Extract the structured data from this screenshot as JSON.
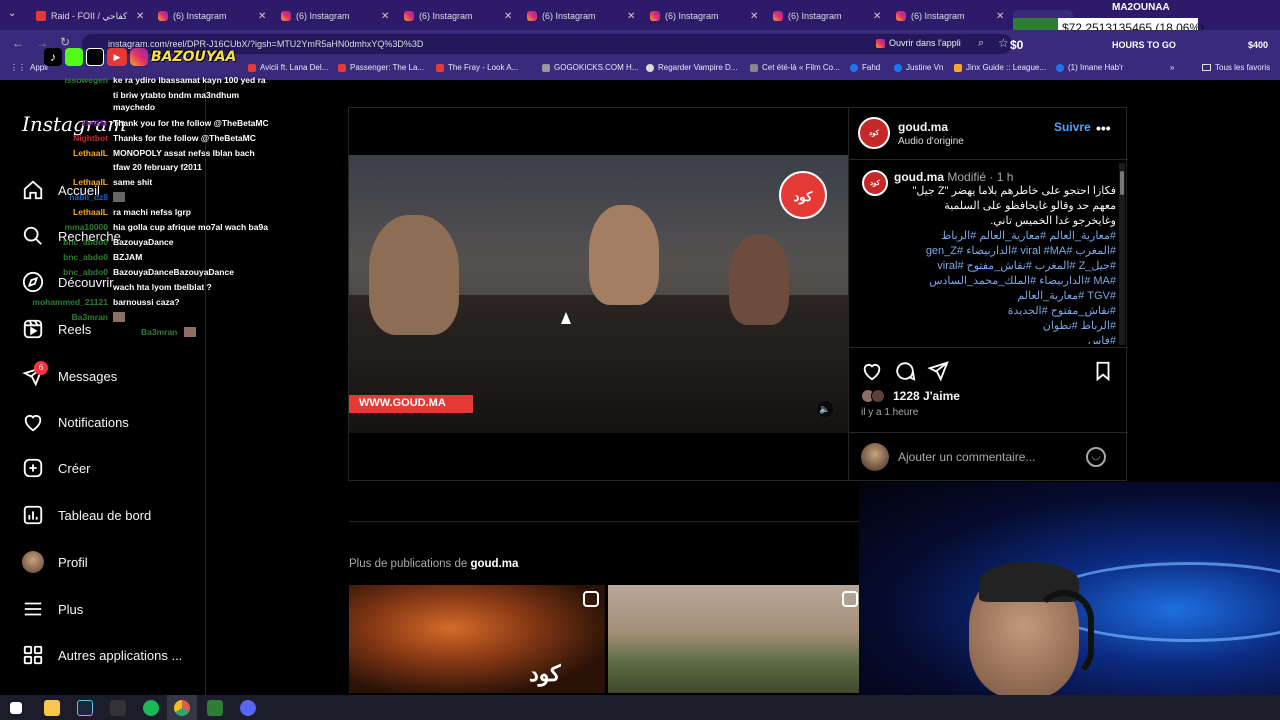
{
  "browser": {
    "tabs": [
      {
        "label": "Raid - FOII / كفاحي",
        "icon": "youtube-icon"
      },
      {
        "label": "(6) Instagram",
        "icon": "instagram-icon"
      },
      {
        "label": "(6) Instagram",
        "icon": "instagram-icon"
      },
      {
        "label": "(6) Instagram",
        "icon": "instagram-icon"
      },
      {
        "label": "(6) Instagram",
        "icon": "instagram-icon"
      },
      {
        "label": "(6) Instagram",
        "icon": "instagram-icon"
      },
      {
        "label": "(6) Instagram",
        "icon": "instagram-icon"
      },
      {
        "label": "(6) Instagram",
        "icon": "instagram-icon"
      }
    ],
    "url": "instagram.com/reel/DPR-J16CUbX/?igsh=MTU2YmR5aHN0dmhxYQ%3D%3D",
    "open_in_app": "Ouvrir dans l'appli",
    "bookmarks": [
      "Avicii ft. Lana Del...",
      "Passenger: The La...",
      "The Fray - Look A...",
      "GOGOKICKS.COM H...",
      "Regarder Vampire D...",
      "Cet été-là « Film Co...",
      "Fahd",
      "Justine Vn",
      "Jinx Guide :: League...",
      "(1) Imane Hab'r"
    ],
    "all_bookmarks": "Tous les favoris",
    "apps_label": "Appli"
  },
  "overlay": {
    "price": "$72.2513135465 (18.06%)",
    "counter": "$0",
    "hours": "HOURS TO GO",
    "streamer_name": "MA2OUNAA",
    "money": "$400",
    "social_handle": "BAZOUYAA"
  },
  "chat": [
    {
      "user": "issowegen",
      "msg": "ke ra ydiro lbassamat kayn 100 yed ra",
      "color": "#2e7d32"
    },
    {
      "user": "",
      "msg": "ti briw ytabto bndm ma3ndhum",
      "color": "#2e7d32"
    },
    {
      "user": "",
      "msg": "maychedo",
      "color": "#2e7d32"
    },
    {
      "user": "BetMc",
      "msg": "Thank you for the follow @TheBetaMC",
      "color": "#6a1b9a"
    },
    {
      "user": "Nightbot",
      "msg": "Thanks for the follow @TheBetaMC",
      "color": "#c62828"
    },
    {
      "user": "LethaalL",
      "msg": "MONOPOLY assat nefss lblan bach",
      "color": "#f9a825"
    },
    {
      "user": "",
      "msg": "tfaw 20 february f2011",
      "color": "#f9a825"
    },
    {
      "user": "LethaalL",
      "msg": "same shit",
      "color": "#f9a825"
    },
    {
      "user": "nabil_dz8",
      "msg": "",
      "color": "#1565c0"
    },
    {
      "user": "LethaalL",
      "msg": "ra machi nefss lgrp",
      "color": "#f9a825"
    },
    {
      "user": "mma10000",
      "msg": "hia golla cup afrique mo7al wach ba9a",
      "color": "#2e7d32"
    },
    {
      "user": "bnc_abdo0",
      "msg": "BazouyaDance",
      "color": "#2e7d32"
    },
    {
      "user": "bnc_abdo0",
      "msg": "BZJAM",
      "color": "#2e7d32"
    },
    {
      "user": "bnc_abdo0",
      "msg": "BazouyaDanceBazouyaDance",
      "color": "#2e7d32"
    },
    {
      "user": "",
      "msg": "wach hta lyom tbelblat ?",
      "color": "#2e7d32"
    },
    {
      "user": "mohammed_21121",
      "msg": "barnoussi caza?",
      "color": "#2e7d32"
    },
    {
      "user": "Ba3mran",
      "msg": "",
      "color": "#2e7d32"
    },
    {
      "user": "Ba3mran",
      "msg": "",
      "color": "#2e7d32"
    }
  ],
  "instagram": {
    "logo": "Instagram",
    "nav": [
      {
        "label": "Accueil",
        "icon": "home-icon",
        "badge": ""
      },
      {
        "label": "Recherche",
        "icon": "search-icon",
        "badge": ""
      },
      {
        "label": "Découvrir",
        "icon": "compass-icon",
        "badge": ""
      },
      {
        "label": "Reels",
        "icon": "reels-icon",
        "badge": ""
      },
      {
        "label": "Messages",
        "icon": "messages-icon",
        "badge": "6"
      },
      {
        "label": "Notifications",
        "icon": "heart-icon",
        "badge": ""
      },
      {
        "label": "Créer",
        "icon": "create-icon",
        "badge": ""
      },
      {
        "label": "Tableau de bord",
        "icon": "dashboard-icon",
        "badge": ""
      },
      {
        "label": "Profil",
        "icon": "profile-avatar",
        "badge": ""
      },
      {
        "label": "Plus",
        "icon": "menu-icon",
        "badge": ""
      },
      {
        "label": "Autres applications ...",
        "icon": "apps-icon",
        "badge": ""
      }
    ],
    "post": {
      "username": "goud.ma",
      "audio": "Audio d'origine",
      "follow": "Suivre",
      "edited": "Modifié",
      "time": "1 h",
      "caption_lines": [
        "فكازا احتجو على خاطرهم بلاما يهضر \"Z جيل\"",
        "معهم حد وقالو غايحافظو على السلمية",
        "وغايخرجو غدا الخميس تاني."
      ],
      "tag_lines": [
        "#معارية_العالم #معارية_العالم #الرباط",
        "#المغرب #viral #MA #الداربيضاء #gen_Z",
        "#جيل_Z #المغرب #نقاش_مفتوح #viral",
        "#MA #الداربيضاء #الملك_محمد_السادس",
        "#TGV #معارية_العالم",
        "#نقاش_مفتوح #الجديدة",
        "#الرباط #تطوان",
        "#فاس"
      ],
      "likes": "1228 J'aime",
      "posted": "il y a 1 heure",
      "comment_placeholder": "Ajouter un commentaire...",
      "video_watermark": "WWW.GOUD.MA",
      "brand_logo": "كود"
    },
    "more_prefix": "Plus de publications de",
    "more_user": "goud.ma"
  }
}
